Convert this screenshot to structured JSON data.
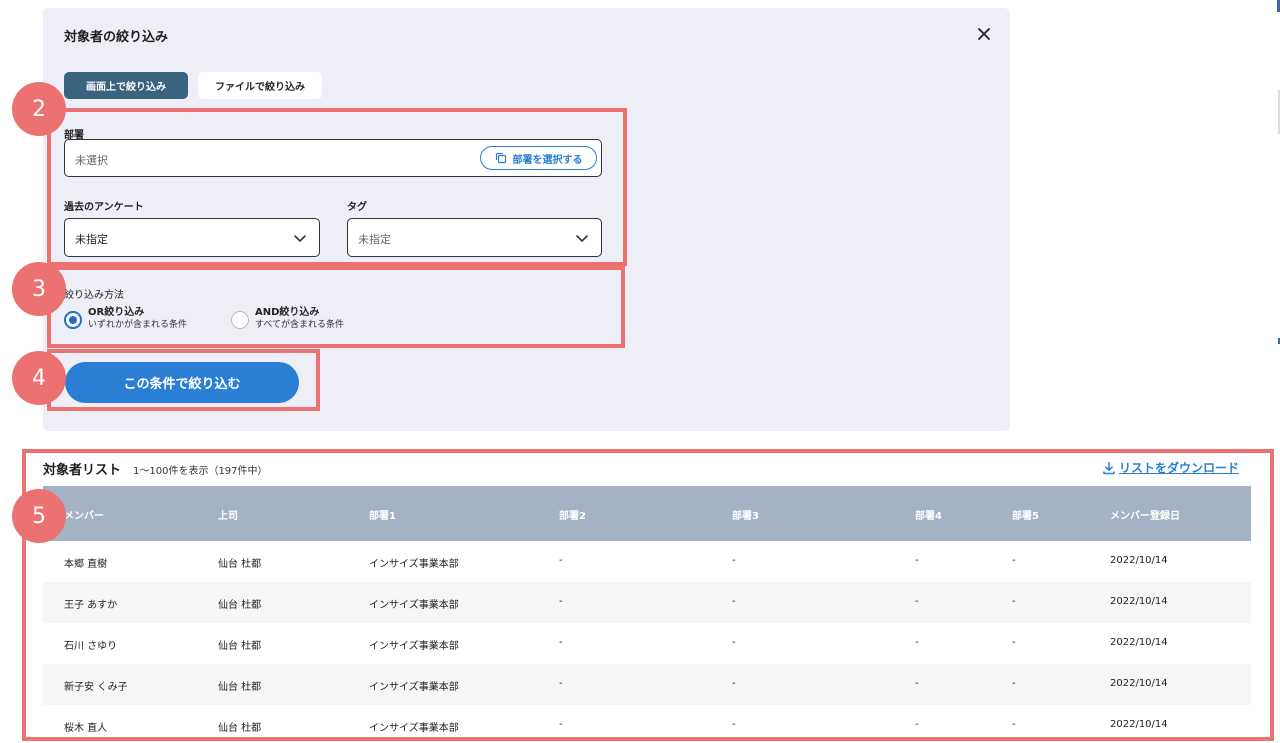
{
  "filter_panel": {
    "title": "対象者の絞り込み",
    "tabs": [
      {
        "label": "画面上で絞り込み",
        "active": true
      },
      {
        "label": "ファイルで絞り込み",
        "active": false
      }
    ],
    "department": {
      "label": "部署",
      "placeholder": "未選択",
      "select_button": "部署を選択する"
    },
    "past_survey": {
      "label": "過去のアンケート",
      "value": "未指定"
    },
    "tag": {
      "label": "タグ",
      "placeholder": "未指定"
    },
    "method": {
      "label": "絞り込み方法",
      "options": [
        {
          "title": "OR絞り込み",
          "desc": "いずれかが含まれる条件",
          "selected": true
        },
        {
          "title": "AND絞り込み",
          "desc": "すべてが含まれる条件",
          "selected": false
        }
      ]
    },
    "apply_button": "この条件で絞り込む"
  },
  "badges": [
    "2",
    "3",
    "4",
    "5"
  ],
  "list": {
    "title": "対象者リスト",
    "count": "1〜100件を表示（197件中）",
    "download": "リストをダウンロード",
    "columns": [
      "メンバー",
      "上司",
      "部署1",
      "部署2",
      "部署3",
      "部署4",
      "部署5",
      "メンバー登録日"
    ],
    "rows": [
      [
        "本郷 直樹",
        "仙台 杜都",
        "インサイズ事業本部",
        "-",
        "-",
        "-",
        "-",
        "2022/10/14"
      ],
      [
        "王子 あすか",
        "仙台 杜都",
        "インサイズ事業本部",
        "-",
        "-",
        "-",
        "-",
        "2022/10/14"
      ],
      [
        "石川 さゆり",
        "仙台 杜都",
        "インサイズ事業本部",
        "-",
        "-",
        "-",
        "-",
        "2022/10/14"
      ],
      [
        "新子安 くみ子",
        "仙台 杜都",
        "インサイズ事業本部",
        "-",
        "-",
        "-",
        "-",
        "2022/10/14"
      ],
      [
        "桜木 直人",
        "仙台 杜都",
        "インサイズ事業本部",
        "-",
        "-",
        "-",
        "-",
        "2022/10/14"
      ]
    ]
  },
  "colors": {
    "primary": "#2a7fd4",
    "active_tab": "#3a6380",
    "highlight": "#ec7171",
    "table_header": "#a5b2c3"
  }
}
